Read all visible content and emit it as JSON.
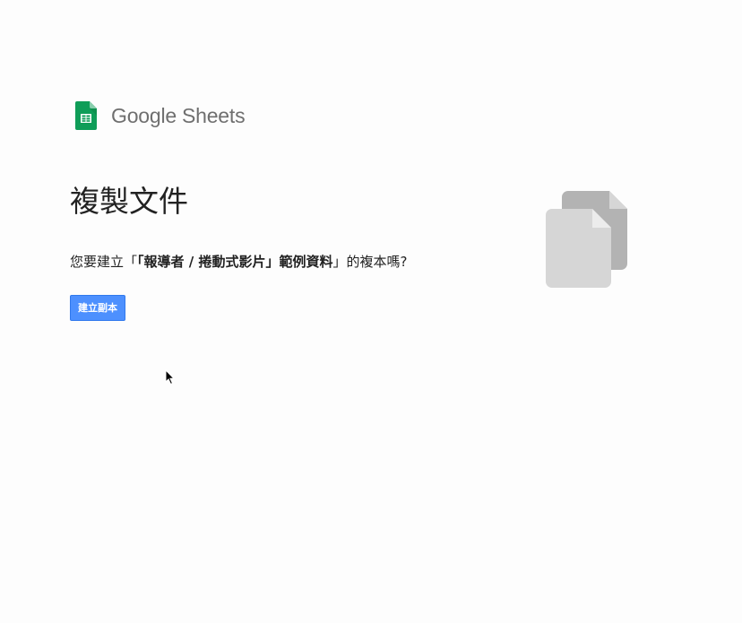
{
  "brand": {
    "google": "Google",
    "app": "Sheets",
    "icon": "google-sheets-icon",
    "color": "#0f9d58"
  },
  "page": {
    "title": "複製文件",
    "prompt_prefix": "您要建立「",
    "document_name": "「報導者 / 捲動式影片」範例資料",
    "prompt_suffix": "」的複本嗎?",
    "graphic": "copy-documents-icon"
  },
  "actions": {
    "make_copy_label": "建立副本"
  },
  "colors": {
    "button": "#4d90fe",
    "button_border": "#3079ed",
    "text": "#222222",
    "logo_text": "#6f6f6f",
    "graphic_back": "#b3b3b3",
    "graphic_front": "#d6d6d6"
  }
}
